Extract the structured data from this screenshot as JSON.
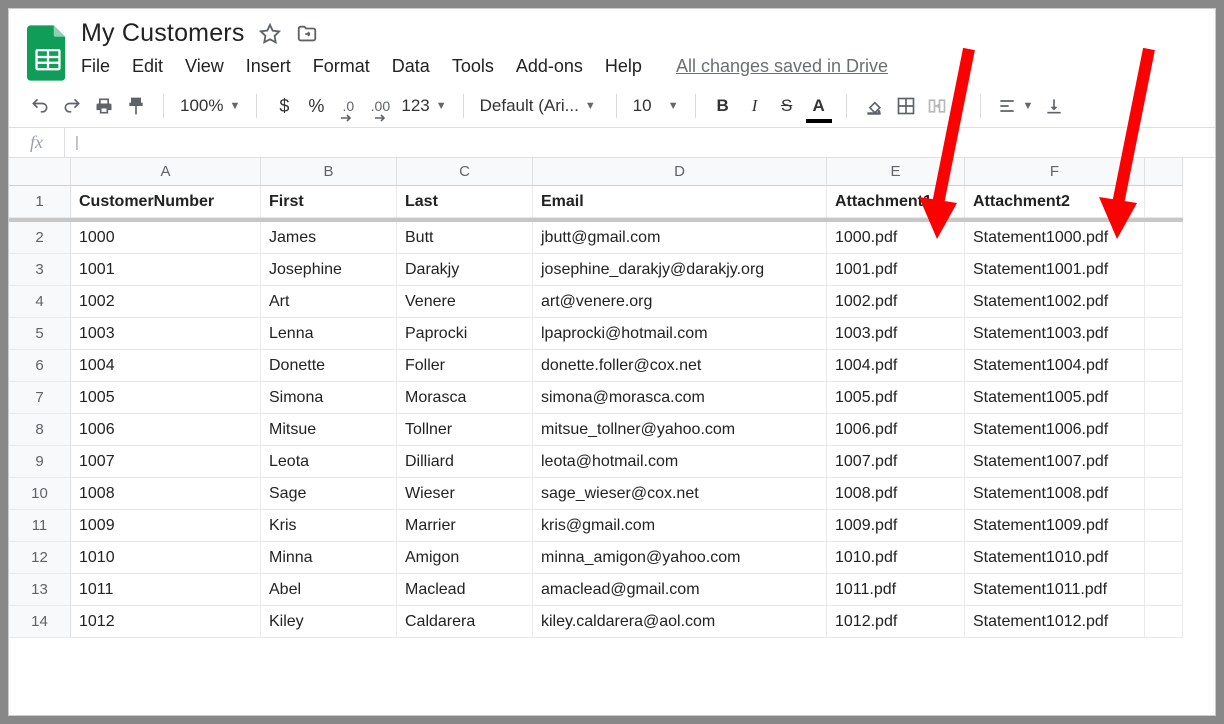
{
  "doc_title": "My Customers",
  "save_message": "All changes saved in Drive",
  "menu": {
    "file": "File",
    "edit": "Edit",
    "view": "View",
    "insert": "Insert",
    "format": "Format",
    "data": "Data",
    "tools": "Tools",
    "addons": "Add-ons",
    "help": "Help"
  },
  "toolbar": {
    "zoom": "100%",
    "currency": "$",
    "percent": "%",
    "dec_less": ".0",
    "dec_more": ".00",
    "numfmt": "123",
    "font": "Default (Ari...",
    "font_size": "10",
    "text_color": "A"
  },
  "fx_label": "fx",
  "fx_value": "",
  "columns": [
    "A",
    "B",
    "C",
    "D",
    "E",
    "F",
    ""
  ],
  "headers": {
    "a": "CustomerNumber",
    "b": "First",
    "c": "Last",
    "d": "Email",
    "e": "Attachment1",
    "f": "Attachment2"
  },
  "rows": [
    {
      "n": "1000",
      "first": "James",
      "last": "Butt",
      "email": "jbutt@gmail.com",
      "a1": "1000.pdf",
      "a2": "Statement1000.pdf"
    },
    {
      "n": "1001",
      "first": "Josephine",
      "last": "Darakjy",
      "email": "josephine_darakjy@darakjy.org",
      "a1": "1001.pdf",
      "a2": "Statement1001.pdf"
    },
    {
      "n": "1002",
      "first": "Art",
      "last": "Venere",
      "email": "art@venere.org",
      "a1": "1002.pdf",
      "a2": "Statement1002.pdf"
    },
    {
      "n": "1003",
      "first": "Lenna",
      "last": "Paprocki",
      "email": "lpaprocki@hotmail.com",
      "a1": "1003.pdf",
      "a2": "Statement1003.pdf"
    },
    {
      "n": "1004",
      "first": "Donette",
      "last": "Foller",
      "email": "donette.foller@cox.net",
      "a1": "1004.pdf",
      "a2": "Statement1004.pdf"
    },
    {
      "n": "1005",
      "first": "Simona",
      "last": "Morasca",
      "email": "simona@morasca.com",
      "a1": "1005.pdf",
      "a2": "Statement1005.pdf"
    },
    {
      "n": "1006",
      "first": "Mitsue",
      "last": "Tollner",
      "email": "mitsue_tollner@yahoo.com",
      "a1": "1006.pdf",
      "a2": "Statement1006.pdf"
    },
    {
      "n": "1007",
      "first": "Leota",
      "last": "Dilliard",
      "email": "leota@hotmail.com",
      "a1": "1007.pdf",
      "a2": "Statement1007.pdf"
    },
    {
      "n": "1008",
      "first": "Sage",
      "last": "Wieser",
      "email": "sage_wieser@cox.net",
      "a1": "1008.pdf",
      "a2": "Statement1008.pdf"
    },
    {
      "n": "1009",
      "first": "Kris",
      "last": "Marrier",
      "email": "kris@gmail.com",
      "a1": "1009.pdf",
      "a2": "Statement1009.pdf"
    },
    {
      "n": "1010",
      "first": "Minna",
      "last": "Amigon",
      "email": "minna_amigon@yahoo.com",
      "a1": "1010.pdf",
      "a2": "Statement1010.pdf"
    },
    {
      "n": "1011",
      "first": "Abel",
      "last": "Maclead",
      "email": "amaclead@gmail.com",
      "a1": "1011.pdf",
      "a2": "Statement1011.pdf"
    },
    {
      "n": "1012",
      "first": "Kiley",
      "last": "Caldarera",
      "email": "kiley.caldarera@aol.com",
      "a1": "1012.pdf",
      "a2": "Statement1012.pdf"
    }
  ],
  "row_numbers": [
    "1",
    "2",
    "3",
    "4",
    "5",
    "6",
    "7",
    "8",
    "9",
    "10",
    "11",
    "12",
    "13",
    "14"
  ]
}
